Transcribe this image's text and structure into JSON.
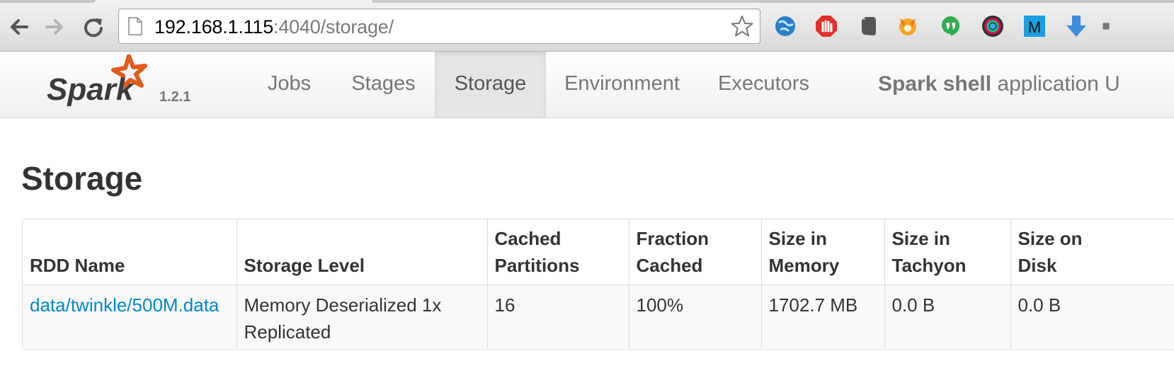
{
  "browser": {
    "url_host": "192.168.1.115",
    "url_rest": ":4040/storage/",
    "extensions": [
      "globe-icon",
      "adblock-icon",
      "evernote-icon",
      "fox-icon",
      "hangouts-icon",
      "camera-icon",
      "m-icon",
      "download-icon"
    ],
    "m_letter": "M"
  },
  "navbar": {
    "logo_text": "Spark",
    "version": "1.2.1",
    "tabs": [
      {
        "label": "Jobs",
        "active": false
      },
      {
        "label": "Stages",
        "active": false
      },
      {
        "label": "Storage",
        "active": true
      },
      {
        "label": "Environment",
        "active": false
      },
      {
        "label": "Executors",
        "active": false
      }
    ],
    "app_name_bold": "Spark shell",
    "app_name_rest": " application U"
  },
  "page": {
    "title": "Storage"
  },
  "table": {
    "headers": [
      {
        "line1": "",
        "line2": "RDD Name"
      },
      {
        "line1": "",
        "line2": "Storage Level"
      },
      {
        "line1": "Cached",
        "line2": "Partitions"
      },
      {
        "line1": "Fraction",
        "line2": "Cached"
      },
      {
        "line1": "Size in",
        "line2": "Memory"
      },
      {
        "line1": "Size in",
        "line2": "Tachyon"
      },
      {
        "line1": "Size on",
        "line2": "Disk"
      }
    ],
    "rows": [
      {
        "rdd_name": "data/twinkle/500M.data",
        "storage_level_1": "Memory Deserialized 1x",
        "storage_level_2": "Replicated",
        "cached_partitions": "16",
        "fraction_cached": "100%",
        "size_memory": "1702.7 MB",
        "size_tachyon": "0.0 B",
        "size_disk": "0.0 B"
      }
    ]
  },
  "colors": {
    "link": "#0088cc",
    "spark_orange": "#e25a1c",
    "text": "#333333"
  }
}
